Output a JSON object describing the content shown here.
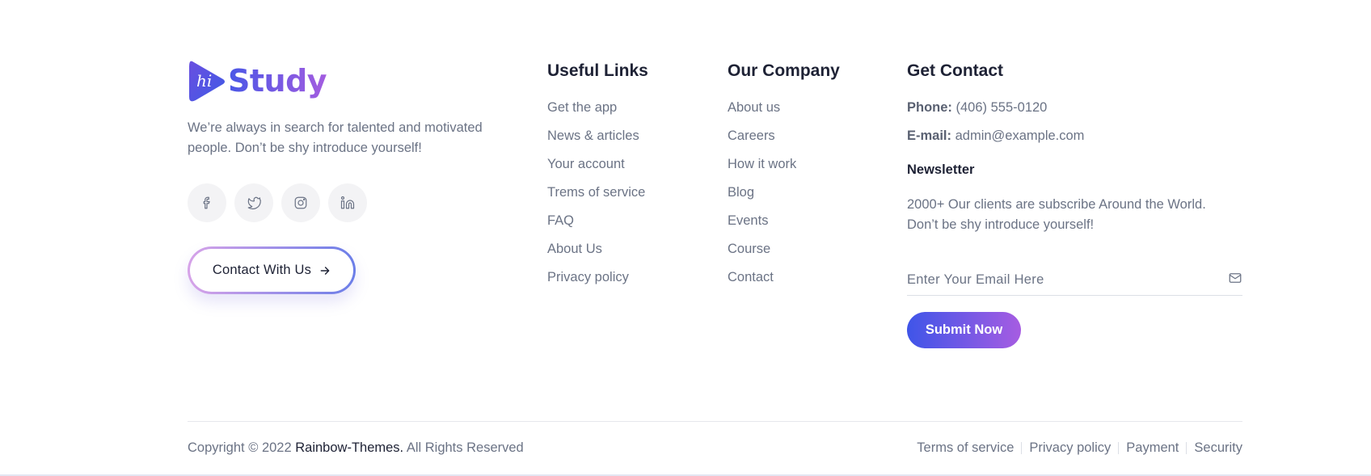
{
  "brand": {
    "logo_mark": "hi",
    "logo_text": "Study",
    "accent_start": "#4a57e6",
    "accent_end": "#a35ce0"
  },
  "about": {
    "text": "We’re always in search for talented and motivated people. Don’t be shy introduce yourself!",
    "socials": [
      {
        "icon": "facebook-icon"
      },
      {
        "icon": "twitter-icon"
      },
      {
        "icon": "instagram-icon"
      },
      {
        "icon": "linkedin-icon"
      }
    ],
    "contact_button": "Contact With Us"
  },
  "useful_links": {
    "title": "Useful Links",
    "items": [
      "Get the app",
      "News & articles",
      "Your account",
      "Trems of service",
      "FAQ",
      "About Us",
      "Privacy policy"
    ]
  },
  "our_company": {
    "title": "Our Company",
    "items": [
      "About us",
      "Careers",
      "How it work",
      "Blog",
      "Events",
      "Course",
      "Contact"
    ]
  },
  "get_contact": {
    "title": "Get Contact",
    "phone_label": "Phone:",
    "phone_value": "(406) 555-0120",
    "email_label": "E-mail:",
    "email_value": "admin@example.com",
    "newsletter_title": "Newsletter",
    "newsletter_text": "2000+ Our clients are subscribe Around the World. Don’t be shy introduce yourself!",
    "email_placeholder": "Enter Your Email Here",
    "submit_label": "Submit Now"
  },
  "bottom": {
    "copyright_prefix": "Copyright © 2022",
    "copyright_brand": "Rainbow-Themes.",
    "copyright_suffix": "All Rights Reserved",
    "links": [
      "Terms of service",
      "Privacy policy",
      "Payment",
      "Security"
    ]
  }
}
